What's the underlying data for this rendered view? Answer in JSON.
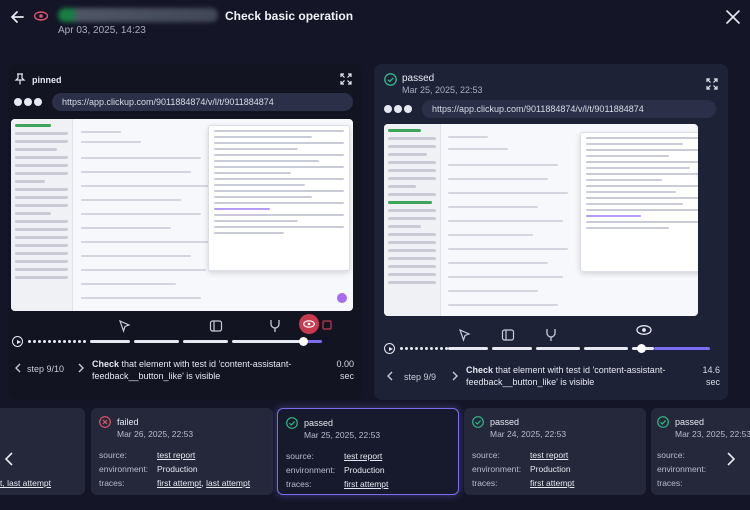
{
  "header": {
    "title": "Check basic operation",
    "date": "Apr 03, 2025, 14:23"
  },
  "left_panel": {
    "label": "pinned",
    "url": "https://app.clickup.com/9011884874/v/l/t/9011884874",
    "step": "step 9/10",
    "description_bold": "Check",
    "description_rest": " that element with test id 'content-assistant-feedback__button_like' is visible",
    "duration_value": "0.00",
    "duration_unit": "sec"
  },
  "right_panel": {
    "status": "passed",
    "date": "Mar 25, 2025, 22:53",
    "url": "https://app.clickup.com/9011884874/v/l/t/9011884874",
    "step": "step 9/9",
    "description_bold": "Check",
    "description_rest": " that element with test id 'content-assistant-feedback__button_like' is visible",
    "duration_value": "14.6",
    "duration_unit": "sec"
  },
  "runs": {
    "partial_left_text": "t, last attempt",
    "labels": {
      "source": "source:",
      "environment": "environment:",
      "traces": "traces:"
    },
    "items": [
      {
        "status": "failed",
        "date": "Mar 26, 2025, 22:53",
        "source": "test report",
        "environment": "Production",
        "trace_first": "first attempt",
        "trace_sep": ", ",
        "trace_last": "last attempt"
      },
      {
        "status": "passed",
        "date": "Mar 25, 2025, 22:53",
        "source": "test report",
        "environment": "Production",
        "trace_first": "first attempt"
      },
      {
        "status": "passed",
        "date": "Mar 24, 2025, 22:53",
        "source": "test report",
        "environment": "Production",
        "trace_first": "first attempt"
      }
    ],
    "partial_right": {
      "status": "passed",
      "date": "Mar 23, 2025, 22:53"
    }
  },
  "colors": {
    "accent": "#7b6df0",
    "passed": "#2eb98a",
    "failed": "#e0566b",
    "record": "#c93a50"
  }
}
